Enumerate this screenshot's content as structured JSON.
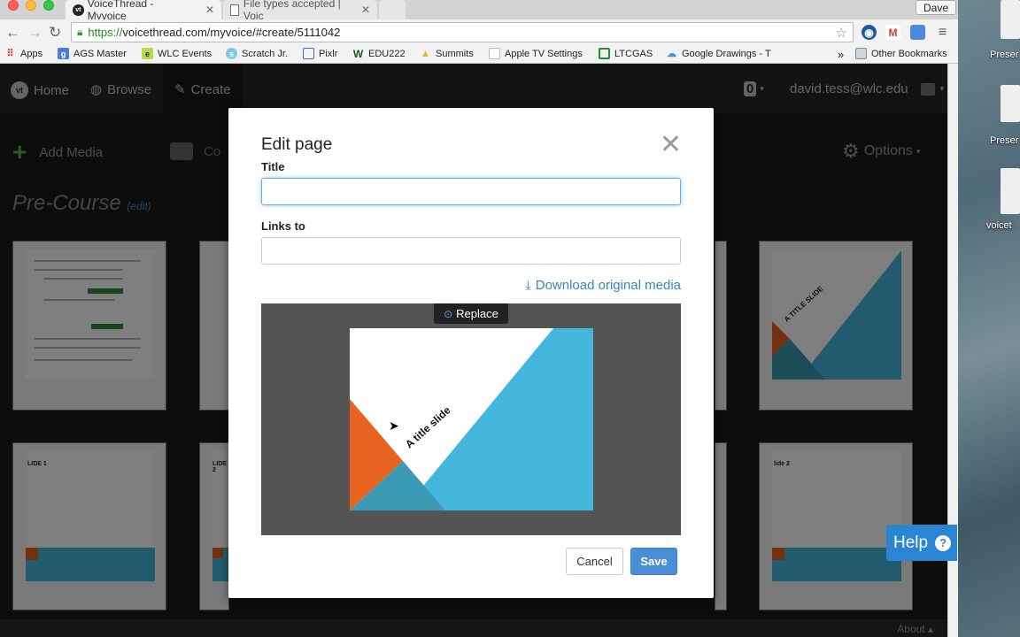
{
  "browser": {
    "tabs": [
      {
        "title": "VoiceThread - Myvoice",
        "active": true
      },
      {
        "title": "File types accepted | Voic",
        "active": false
      }
    ],
    "profile_name": "Dave",
    "url_scheme": "https://",
    "url_rest": "voicethread.com/myvoice/#create/5111042",
    "bookmarks": [
      {
        "label": "Apps",
        "icon": "apps-grid-icon"
      },
      {
        "label": "AGS Master",
        "icon": "google-icon"
      },
      {
        "label": "WLC Events",
        "icon": "events-icon"
      },
      {
        "label": "Scratch Jr.",
        "icon": "scratch-icon"
      },
      {
        "label": "Pixlr",
        "icon": "pixlr-icon"
      },
      {
        "label": "EDU222",
        "icon": "w-icon"
      },
      {
        "label": "Summits",
        "icon": "drive-icon"
      },
      {
        "label": "Apple TV Settings",
        "icon": "doc-icon"
      },
      {
        "label": "LTCGAS",
        "icon": "sheet-icon"
      },
      {
        "label": "Google Drawings - T",
        "icon": "drawings-icon"
      }
    ],
    "more_bookmarks": "»",
    "other_bookmarks": "Other Bookmarks"
  },
  "voicethread": {
    "nav": {
      "home": "Home",
      "browse": "Browse",
      "create": "Create",
      "notifications": "0",
      "user_email": "david.tess@wlc.edu"
    },
    "toolbar": {
      "add_media": "Add Media",
      "comment": "Co",
      "options": "Options"
    },
    "thread_title": "Pre-Course",
    "edit_link": "(edit)",
    "slide_labels": [
      "LIDE 1",
      "LIDE 2",
      "lide 2"
    ],
    "footer_about": "About"
  },
  "modal": {
    "title": "Edit page",
    "title_label": "Title",
    "title_value": "",
    "links_label": "Links to",
    "links_value": "",
    "download_link": "Download original media",
    "replace_button": "Replace",
    "slide_text": "A title slide",
    "cancel_button": "Cancel",
    "save_button": "Save"
  },
  "help": {
    "label": "Help"
  },
  "thumb_text": "A TITLE SLIDE",
  "desktop": {
    "labels": [
      "Preser",
      "Preser",
      "voicet"
    ]
  },
  "colors": {
    "accent_blue": "#4a8fd6",
    "slide_teal": "#46b7dc",
    "slide_orange": "#e8631f",
    "slide_dark_teal": "#3d9ab5",
    "help_blue": "#2a86d3"
  }
}
